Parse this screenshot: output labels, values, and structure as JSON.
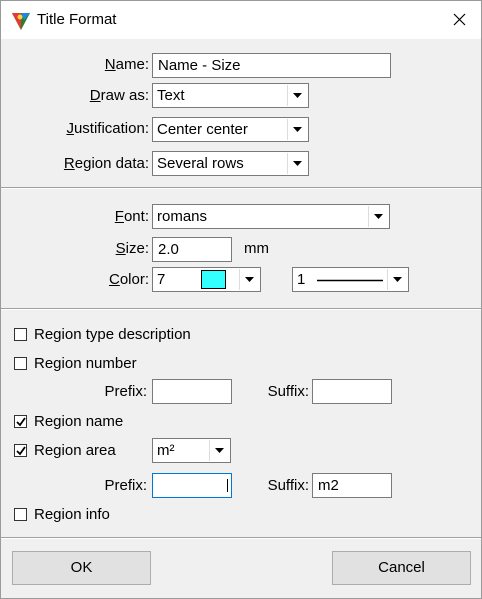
{
  "window": {
    "title": "Title Format"
  },
  "general": {
    "name_label": "Name:",
    "name_value": "Name - Size",
    "draw_as_label": "Draw as:",
    "draw_as_value": "Text",
    "justification_label": "Justification:",
    "justification_value": "Center center",
    "region_data_label": "Region data:",
    "region_data_value": "Several rows"
  },
  "font_section": {
    "font_label": "Font:",
    "font_value": "romans",
    "size_label": "Size:",
    "size_value": "2.0",
    "size_unit": "mm",
    "color_label": "Color:",
    "color_value": "7",
    "color_swatch": "#33ffff",
    "line_weight_value": "1"
  },
  "options": {
    "region_type_description": {
      "label": "Region type description",
      "checked": false
    },
    "region_number": {
      "label": "Region number",
      "checked": false,
      "prefix_label": "Prefix:",
      "prefix_value": "",
      "suffix_label": "Suffix:",
      "suffix_value": ""
    },
    "region_name": {
      "label": "Region name",
      "checked": true
    },
    "region_area": {
      "label": "Region area",
      "checked": true,
      "unit_value": "m²",
      "prefix_label": "Prefix:",
      "prefix_value": "",
      "suffix_label": "Suffix:",
      "suffix_value": "m2"
    },
    "region_info": {
      "label": "Region info",
      "checked": false
    }
  },
  "buttons": {
    "ok": "OK",
    "cancel": "Cancel"
  }
}
